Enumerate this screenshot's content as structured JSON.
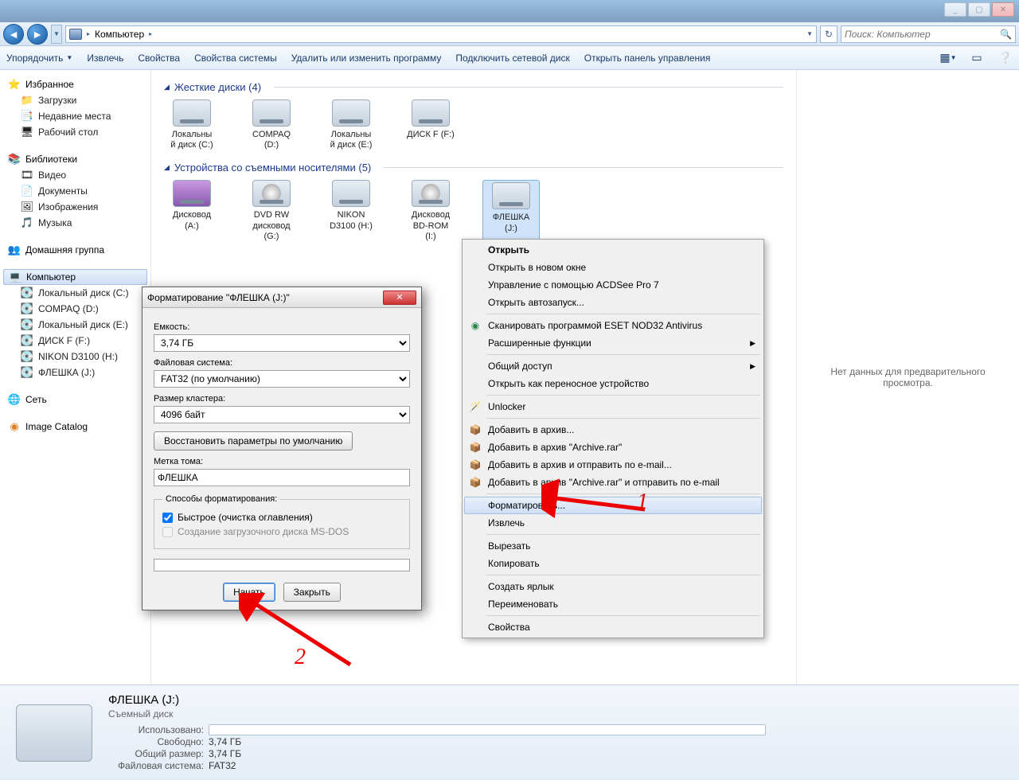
{
  "window": {
    "min": "_",
    "max": "▢",
    "close": "✕"
  },
  "nav": {
    "breadcrumb": "Компьютер",
    "sep": "▸",
    "search_placeholder": "Поиск: Компьютер"
  },
  "toolbar": {
    "organize": "Упорядочить",
    "extract": "Извлечь",
    "properties": "Свойства",
    "sysprops": "Свойства системы",
    "uninstall": "Удалить или изменить программу",
    "mapdrive": "Подключить сетевой диск",
    "controlpanel": "Открыть панель управления"
  },
  "sidebar": {
    "favorites": "Избранное",
    "fav_items": [
      "Загрузки",
      "Недавние места",
      "Рабочий стол"
    ],
    "libraries": "Библиотеки",
    "lib_items": [
      "Видео",
      "Документы",
      "Изображения",
      "Музыка"
    ],
    "homegroup": "Домашняя группа",
    "computer": "Компьютер",
    "comp_items": [
      "Локальный диск (C:)",
      "COMPAQ (D:)",
      "Локальный диск (E:)",
      "ДИСК F (F:)",
      "NIKON D3100 (H:)",
      "ФЛЕШКА (J:)"
    ],
    "network": "Сеть",
    "catalog": "Image Catalog"
  },
  "content": {
    "hdd_header": "Жесткие диски (4)",
    "hdd": [
      {
        "l1": "Локальны",
        "l2": "й диск (C:)"
      },
      {
        "l1": "COMPAQ",
        "l2": "(D:)"
      },
      {
        "l1": "Локальны",
        "l2": "й диск (E:)"
      },
      {
        "l1": "ДИСК F (F:)",
        "l2": ""
      }
    ],
    "rem_header": "Устройства со съемными носителями (5)",
    "rem": [
      {
        "l1": "Дисковод",
        "l2": "(A:)"
      },
      {
        "l1": "DVD RW",
        "l2": "дисковод",
        "l3": "(G:)"
      },
      {
        "l1": "NIKON",
        "l2": "D3100 (H:)"
      },
      {
        "l1": "Дисковод",
        "l2": "BD-ROM",
        "l3": "(I:)"
      },
      {
        "l1": "ФЛЕШКА",
        "l2": "(J:)"
      }
    ]
  },
  "preview": "Нет данных для предварительного просмотра.",
  "ctx": {
    "open": "Открыть",
    "open_new": "Открыть в новом окне",
    "acdsee": "Управление с помощью ACDSee Pro 7",
    "autorun": "Открыть автозапуск...",
    "eset": "Сканировать программой ESET NOD32 Antivirus",
    "advanced": "Расширенные функции",
    "share": "Общий доступ",
    "portable": "Открыть как переносное устройство",
    "unlocker": "Unlocker",
    "arch1": "Добавить в архив...",
    "arch2": "Добавить в архив \"Archive.rar\"",
    "arch3": "Добавить в архив и отправить по e-mail...",
    "arch4": "Добавить в архив \"Archive.rar\" и отправить по e-mail",
    "format": "Форматировать...",
    "eject": "Извлечь",
    "cut": "Вырезать",
    "copy": "Копировать",
    "shortcut": "Создать ярлык",
    "rename": "Переименовать",
    "props": "Свойства"
  },
  "dialog": {
    "title": "Форматирование \"ФЛЕШКА (J:)\"",
    "capacity_lbl": "Емкость:",
    "capacity": "3,74 ГБ",
    "fs_lbl": "Файловая система:",
    "fs": "FAT32 (по умолчанию)",
    "cluster_lbl": "Размер кластера:",
    "cluster": "4096 байт",
    "restore": "Восстановить параметры по умолчанию",
    "label_lbl": "Метка тома:",
    "label": "ФЛЕШКА",
    "methods": "Способы форматирования:",
    "quick": "Быстрое (очистка оглавления)",
    "msdos": "Создание загрузочного диска MS-DOS",
    "start": "Начать",
    "close": "Закрыть"
  },
  "status": {
    "title": "ФЛЕШКА (J:)",
    "subtitle": "Съемный диск",
    "used_lbl": "Использовано:",
    "used": "",
    "free_lbl": "Свободно:",
    "free": "3,74 ГБ",
    "total_lbl": "Общий размер:",
    "total": "3,74 ГБ",
    "fs_lbl": "Файловая система:",
    "fs": "FAT32"
  },
  "anno": {
    "n1": "1",
    "n2": "2"
  }
}
